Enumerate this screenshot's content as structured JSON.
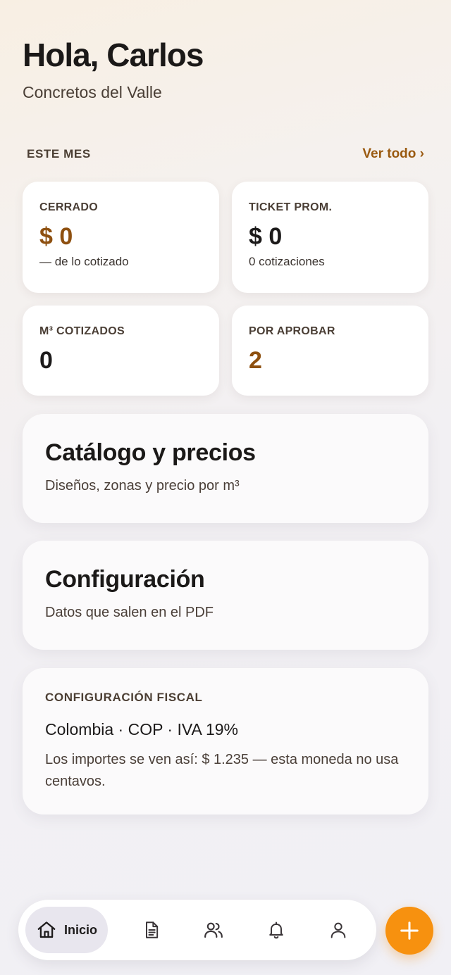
{
  "header": {
    "greeting": "Hola, Carlos",
    "company": "Concretos del Valle"
  },
  "summary": {
    "section_label": "ESTE MES",
    "see_all": "Ver todo ›"
  },
  "stats": [
    {
      "label": "CERRADO",
      "value": "$ 0",
      "sub": "— de lo cotizado"
    },
    {
      "label": "TICKET PROM.",
      "value": "$ 0",
      "sub": "0 cotizaciones"
    },
    {
      "label": "M³ COTIZADOS",
      "value": "0"
    },
    {
      "label": "POR APROBAR",
      "value": "2"
    }
  ],
  "catalog": {
    "title": "Catálogo y precios",
    "subtitle": "Diseños, zonas y precio por m³"
  },
  "settings": {
    "title": "Configuración",
    "subtitle": "Datos que salen en el PDF"
  },
  "fiscal": {
    "label": "CONFIGURACIÓN FISCAL",
    "main": "Colombia · COP · IVA 19%",
    "note": "Los importes se ven así: $ 1.235 — esta moneda no usa centavos."
  },
  "nav": {
    "home_label": "Inicio",
    "icons": [
      "home-icon",
      "document-icon",
      "users-icon",
      "bell-icon",
      "user-icon",
      "plus-icon"
    ]
  },
  "colors": {
    "accent": "#f7910f",
    "accent_text": "#8e5010",
    "link": "#9a5a10"
  }
}
